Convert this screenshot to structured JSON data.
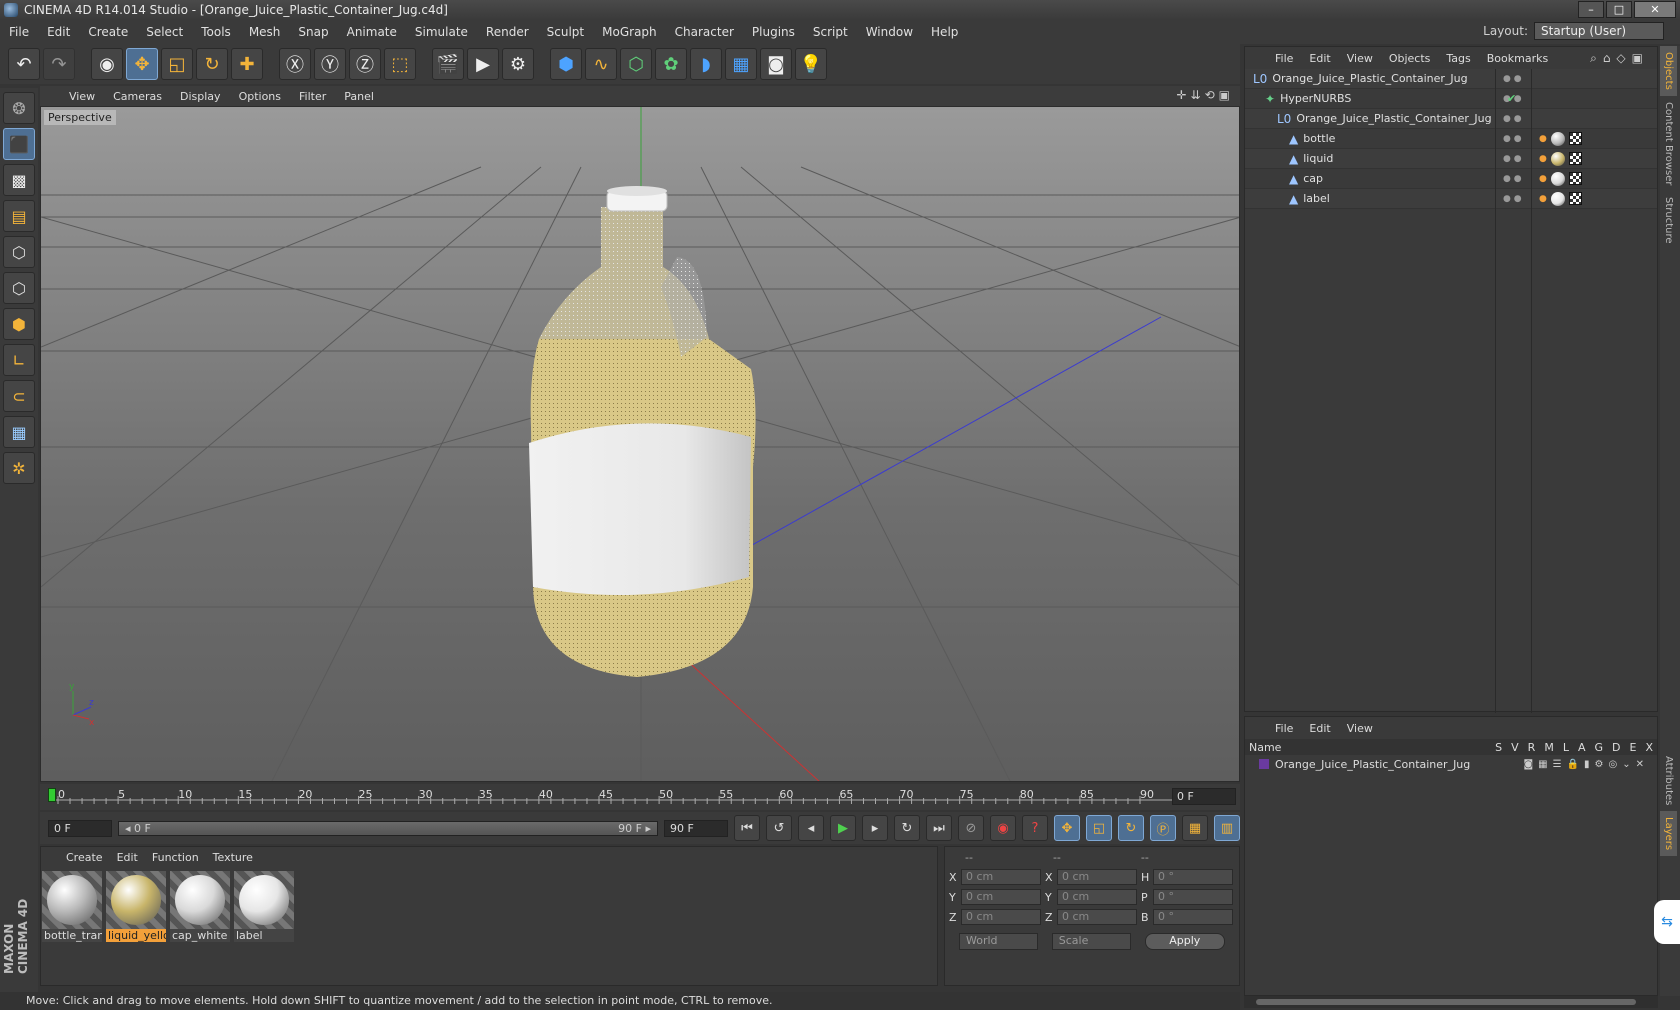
{
  "window": {
    "title": "CINEMA 4D R14.014 Studio - [Orange_Juice_Plastic_Container_Jug.c4d]",
    "minimize": "–",
    "maximize": "□",
    "close": "✕"
  },
  "menubar": [
    "File",
    "Edit",
    "Create",
    "Select",
    "Tools",
    "Mesh",
    "Snap",
    "Animate",
    "Simulate",
    "Render",
    "Sculpt",
    "MoGraph",
    "Character",
    "Plugins",
    "Script",
    "Window",
    "Help"
  ],
  "layout": {
    "label": "Layout:",
    "value": "Startup (User)"
  },
  "viewport": {
    "menu": [
      "View",
      "Cameras",
      "Display",
      "Options",
      "Filter",
      "Panel"
    ],
    "label": "Perspective",
    "nav_icons": "✛⇊⟲▣"
  },
  "timeline": {
    "ticks": [
      "0",
      "5",
      "10",
      "15",
      "20",
      "25",
      "30",
      "35",
      "40",
      "45",
      "50",
      "55",
      "60",
      "65",
      "70",
      "75",
      "80",
      "85",
      "90"
    ],
    "current_frame": "0 F"
  },
  "transport": {
    "start": "0 F",
    "slider_left": "◂ 0 F",
    "slider_right": "90 F ▸",
    "end": "90 F"
  },
  "materials": {
    "menu": [
      "Create",
      "Edit",
      "Function",
      "Texture"
    ],
    "items": [
      {
        "name": "bottle_tran",
        "color": "#b9b9b9",
        "selected": false
      },
      {
        "name": "liquid_yello",
        "color": "#c8b56a",
        "selected": true
      },
      {
        "name": "cap_white",
        "color": "#d9d9d9",
        "selected": false
      },
      {
        "name": "label",
        "color": "#e6e6e6",
        "selected": false
      }
    ]
  },
  "coordinates": {
    "header": [
      "--",
      "--",
      "--"
    ],
    "rows": [
      {
        "a": "X",
        "av": "0 cm",
        "b": "X",
        "bv": "0 cm",
        "c": "H",
        "cv": "0 °"
      },
      {
        "a": "Y",
        "av": "0 cm",
        "b": "Y",
        "bv": "0 cm",
        "c": "P",
        "cv": "0 °"
      },
      {
        "a": "Z",
        "av": "0 cm",
        "b": "Z",
        "bv": "0 cm",
        "c": "B",
        "cv": "0 °"
      }
    ],
    "world": "World",
    "scale": "Scale",
    "apply": "Apply"
  },
  "status": "Move: Click and drag to move elements. Hold down SHIFT to quantize movement / add to the selection in point mode, CTRL to remove.",
  "objects": {
    "menu": [
      "File",
      "Edit",
      "View",
      "Objects",
      "Tags",
      "Bookmarks"
    ],
    "rows": [
      {
        "name": "Orange_Juice_Plastic_Container_Jug",
        "indent": 0,
        "icon": "L0"
      },
      {
        "name": "HyperNURBS",
        "indent": 1,
        "icon": "✦"
      },
      {
        "name": "Orange_Juice_Plastic_Container_Jug",
        "indent": 2,
        "icon": "L0"
      },
      {
        "name": "bottle",
        "indent": 3,
        "icon": "▲"
      },
      {
        "name": "liquid",
        "indent": 3,
        "icon": "▲"
      },
      {
        "name": "cap",
        "indent": 3,
        "icon": "▲"
      },
      {
        "name": "label",
        "indent": 3,
        "icon": "▲"
      }
    ]
  },
  "layers": {
    "menu": [
      "File",
      "Edit",
      "View"
    ],
    "header_name": "Name",
    "columns": [
      "S",
      "V",
      "R",
      "M",
      "L",
      "A",
      "G",
      "D",
      "E",
      "X"
    ],
    "row": "Orange_Juice_Plastic_Container_Jug"
  },
  "sidetabs": [
    "Objects",
    "Content Browser",
    "Structure",
    "Attributes",
    "Layers"
  ],
  "brand": "MAXON CINEMA 4D",
  "colors": {
    "accent": "#f3b43a",
    "selection": "#4e6f93",
    "liquid": "#c8b56a"
  }
}
